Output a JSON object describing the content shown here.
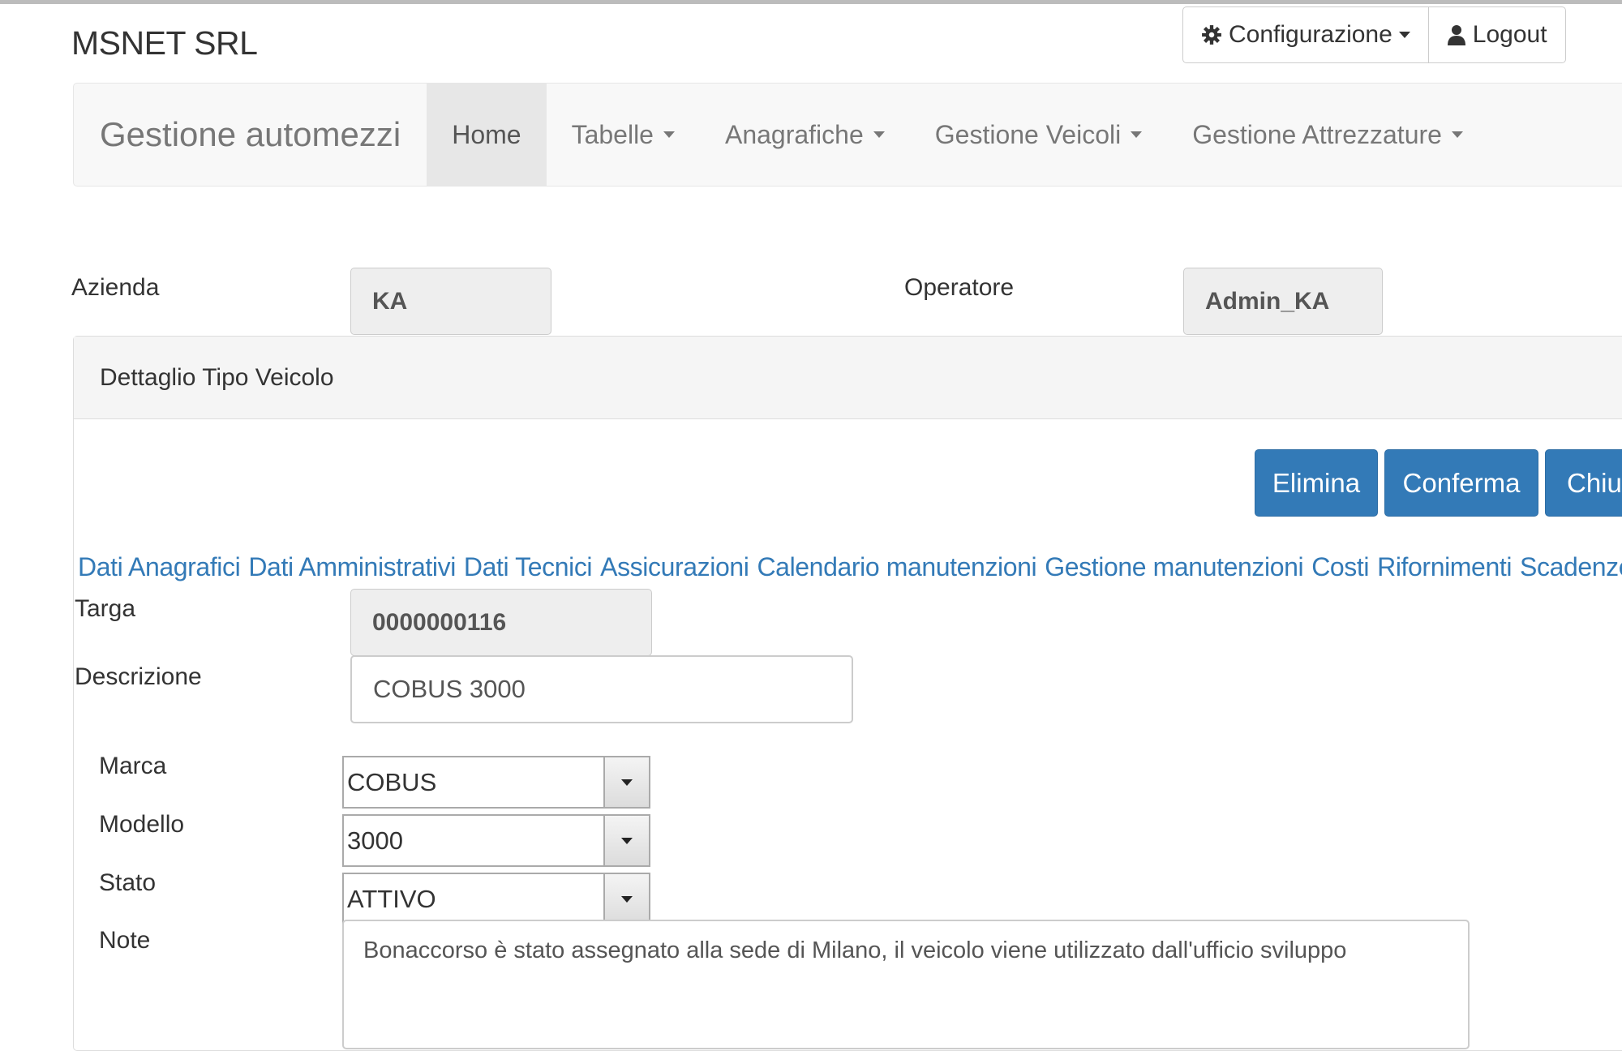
{
  "app": {
    "company": "MSNET SRL"
  },
  "userbar": {
    "config_label": "Configurazione",
    "logout_label": "Logout"
  },
  "navbar": {
    "brand": "Gestione automezzi",
    "items": [
      {
        "label": "Home",
        "active": true
      },
      {
        "label": "Tabelle",
        "dropdown": true
      },
      {
        "label": "Anagrafiche",
        "dropdown": true
      },
      {
        "label": "Gestione Veicoli",
        "dropdown": true
      },
      {
        "label": "Gestione Attrezzature",
        "dropdown": true
      }
    ]
  },
  "header": {
    "azienda_label": "Azienda",
    "azienda_value": "KA",
    "operatore_label": "Operatore",
    "operatore_value": "Admin_KA"
  },
  "panel": {
    "title": "Dettaglio Tipo Veicolo"
  },
  "actions": {
    "delete": "Elimina",
    "confirm": "Conferma",
    "close": "Chiud"
  },
  "tabs": [
    "Dati Anagrafici",
    "Dati Amministrativi",
    "Dati Tecnici",
    "Assicurazioni",
    "Calendario manutenzioni",
    "Gestione manutenzioni",
    "Costi",
    "Rifornimenti",
    "Scadenze"
  ],
  "form": {
    "targa_label": "Targa",
    "targa_value": "0000000116",
    "descrizione_label": "Descrizione",
    "descrizione_value": "COBUS 3000",
    "marca_label": "Marca",
    "marca_value": "COBUS",
    "modello_label": "Modello",
    "modello_value": "3000",
    "stato_label": "Stato",
    "stato_value": "ATTIVO",
    "note_label": "Note",
    "note_value": "Bonaccorso è stato assegnato alla sede di Milano, il veicolo viene utilizzato dall'ufficio sviluppo"
  },
  "colors": {
    "primary": "#337ab7",
    "link": "#337ab7",
    "navbar_bg": "#f8f8f8"
  }
}
